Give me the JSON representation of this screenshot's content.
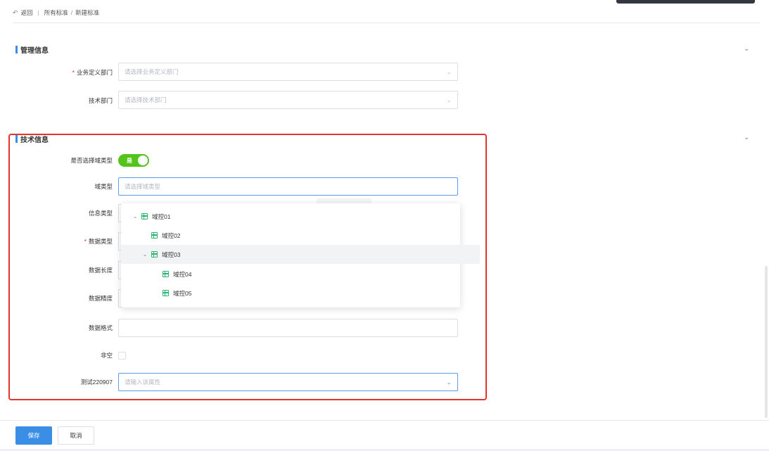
{
  "breadcrumb": {
    "back": "返回",
    "root": "所有标准",
    "current": "新建标准"
  },
  "management": {
    "title": "管理信息",
    "biz_dept": {
      "label": "业务定义部门",
      "placeholder": "请选择业务定义部门"
    },
    "tech_dept": {
      "label": "技术部门",
      "placeholder": "请选择技术部门"
    }
  },
  "technical": {
    "title": "技术信息",
    "domain_toggle": {
      "label": "是否选择域类型",
      "value": "是"
    },
    "domain_type": {
      "label": "域类型",
      "placeholder": "请选择域类型"
    },
    "info_type": {
      "label": "信息类型"
    },
    "data_type": {
      "label": "数据类型"
    },
    "data_length": {
      "label": "数据长度"
    },
    "data_precision": {
      "label": "数据精度"
    },
    "data_format": {
      "label": "数据格式"
    },
    "not_null": {
      "label": "非空"
    },
    "test_field": {
      "label": "测试220907",
      "placeholder": "请输入该属性"
    }
  },
  "domain_tree": [
    {
      "label": "域控01",
      "expandable": true
    },
    {
      "label": "域控02",
      "expandable": false
    },
    {
      "label": "域控03",
      "expandable": true
    },
    {
      "label": "域控04",
      "expandable": false
    },
    {
      "label": "域控05",
      "expandable": false
    }
  ],
  "footer": {
    "save": "保存",
    "cancel": "取消"
  },
  "colors": {
    "primary": "#3a8ee6",
    "toggle_on": "#52c41a",
    "highlight": "#e5322c",
    "tree_icon": "#2bb673"
  }
}
